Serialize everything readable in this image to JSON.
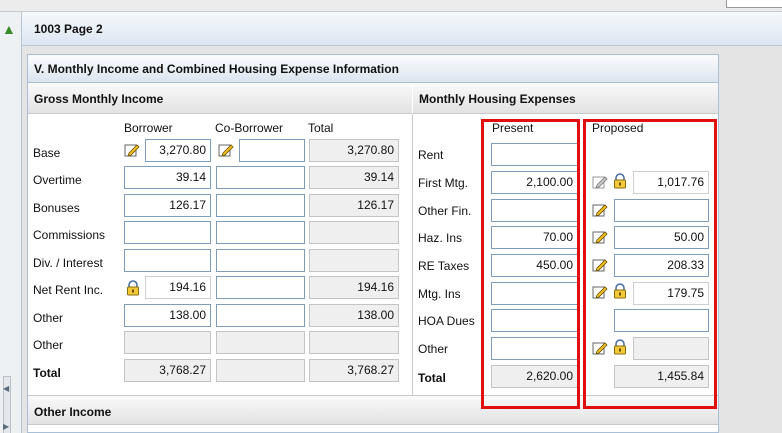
{
  "page_title": "1003 Page 2",
  "section_title": "V. Monthly Income and Combined Housing Expense Information",
  "income": {
    "header": "Gross Monthly Income",
    "col_borrower": "Borrower",
    "col_coborrower": "Co-Borrower",
    "col_total": "Total",
    "rows": [
      {
        "label": "Base",
        "borrower": "3,270.80",
        "coborrower": "",
        "total": "3,270.80"
      },
      {
        "label": "Overtime",
        "borrower": "39.14",
        "coborrower": "",
        "total": "39.14"
      },
      {
        "label": "Bonuses",
        "borrower": "126.17",
        "coborrower": "",
        "total": "126.17"
      },
      {
        "label": "Commissions",
        "borrower": "",
        "coborrower": "",
        "total": ""
      },
      {
        "label": "Div. / Interest",
        "borrower": "",
        "coborrower": "",
        "total": ""
      },
      {
        "label": "Net Rent Inc.",
        "borrower": "194.16",
        "coborrower": "",
        "total": "194.16"
      },
      {
        "label": "Other",
        "borrower": "138.00",
        "coborrower": "",
        "total": "138.00"
      },
      {
        "label": "Other",
        "borrower": "",
        "coborrower": "",
        "total": ""
      }
    ],
    "total_label": "Total",
    "total_borrower": "3,768.27",
    "total_coborrower": "",
    "total_total": "3,768.27"
  },
  "housing": {
    "header": "Monthly Housing Expenses",
    "col_present": "Present",
    "col_proposed": "Proposed",
    "rows": [
      {
        "label": "Rent",
        "present": "",
        "proposed": ""
      },
      {
        "label": "First Mtg.",
        "present": "2,100.00",
        "proposed": "1,017.76"
      },
      {
        "label": "Other Fin.",
        "present": "",
        "proposed": ""
      },
      {
        "label": "Haz. Ins",
        "present": "70.00",
        "proposed": "50.00"
      },
      {
        "label": "RE Taxes",
        "present": "450.00",
        "proposed": "208.33"
      },
      {
        "label": "Mtg. Ins",
        "present": "",
        "proposed": "179.75"
      },
      {
        "label": "HOA Dues",
        "present": "",
        "proposed": ""
      },
      {
        "label": "Other",
        "present": "",
        "proposed": ""
      }
    ],
    "total_label": "Total",
    "total_present": "2,620.00",
    "total_proposed": "1,455.84"
  },
  "other_income_header": "Other Income",
  "colors": {
    "highlight": "#e01010",
    "field_border": "#7f9db9"
  },
  "icons": [
    "edit-pencil-icon",
    "lock-icon",
    "expand-arrow-icon"
  ]
}
